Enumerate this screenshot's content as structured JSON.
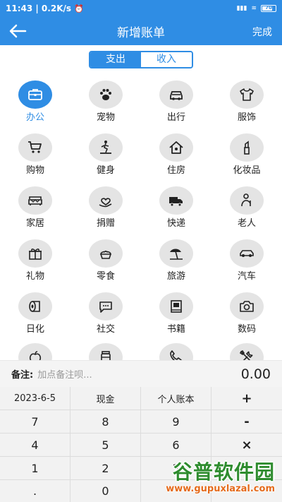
{
  "status_bar": {
    "time": "11:43 | 0.2K/s",
    "battery": "70"
  },
  "app_bar": {
    "title": "新增账单",
    "done": "完成"
  },
  "tabs": [
    {
      "label": "支出",
      "active": true
    },
    {
      "label": "收入",
      "active": false
    }
  ],
  "categories": [
    {
      "label": "办公",
      "icon": "briefcase-icon",
      "active": true
    },
    {
      "label": "宠物",
      "icon": "paw-icon"
    },
    {
      "label": "出行",
      "icon": "car-icon"
    },
    {
      "label": "服饰",
      "icon": "shirt-icon"
    },
    {
      "label": "购物",
      "icon": "cart-icon"
    },
    {
      "label": "健身",
      "icon": "treadmill-icon"
    },
    {
      "label": "住房",
      "icon": "house-icon"
    },
    {
      "label": "化妆品",
      "icon": "lipstick-icon"
    },
    {
      "label": "家居",
      "icon": "sofa-icon"
    },
    {
      "label": "捐赠",
      "icon": "heart-hand-icon"
    },
    {
      "label": "快递",
      "icon": "truck-icon"
    },
    {
      "label": "老人",
      "icon": "elder-icon"
    },
    {
      "label": "礼物",
      "icon": "gift-icon"
    },
    {
      "label": "零食",
      "icon": "snack-icon"
    },
    {
      "label": "旅游",
      "icon": "beach-umbrella-icon"
    },
    {
      "label": "汽车",
      "icon": "sedan-icon"
    },
    {
      "label": "日化",
      "icon": "tissue-roll-icon"
    },
    {
      "label": "社交",
      "icon": "chat-icon"
    },
    {
      "label": "书籍",
      "icon": "book-icon"
    },
    {
      "label": "数码",
      "icon": "camera-icon"
    },
    {
      "label": "",
      "icon": "apple-icon"
    },
    {
      "label": "",
      "icon": "jar-icon"
    },
    {
      "label": "",
      "icon": "phone-icon"
    },
    {
      "label": "",
      "icon": "tools-icon"
    }
  ],
  "remark": {
    "label": "备注:",
    "placeholder": "加点备注呗...",
    "amount": "0.00"
  },
  "keypad": {
    "rows": [
      [
        "2023-6-5",
        "现金",
        "个人账本",
        "+"
      ],
      [
        "7",
        "8",
        "9",
        "-"
      ],
      [
        "4",
        "5",
        "6",
        "×"
      ],
      [
        "1",
        "2",
        "3",
        ""
      ],
      [
        ".",
        "0",
        "",
        ""
      ]
    ]
  },
  "watermark": {
    "title": "谷普软件园",
    "url": "www.gupuxlazal.com"
  },
  "colors": {
    "primary": "#2f8de4",
    "icon_bg": "#e4e4e4",
    "keypad_bg": "#dcdcdc"
  }
}
